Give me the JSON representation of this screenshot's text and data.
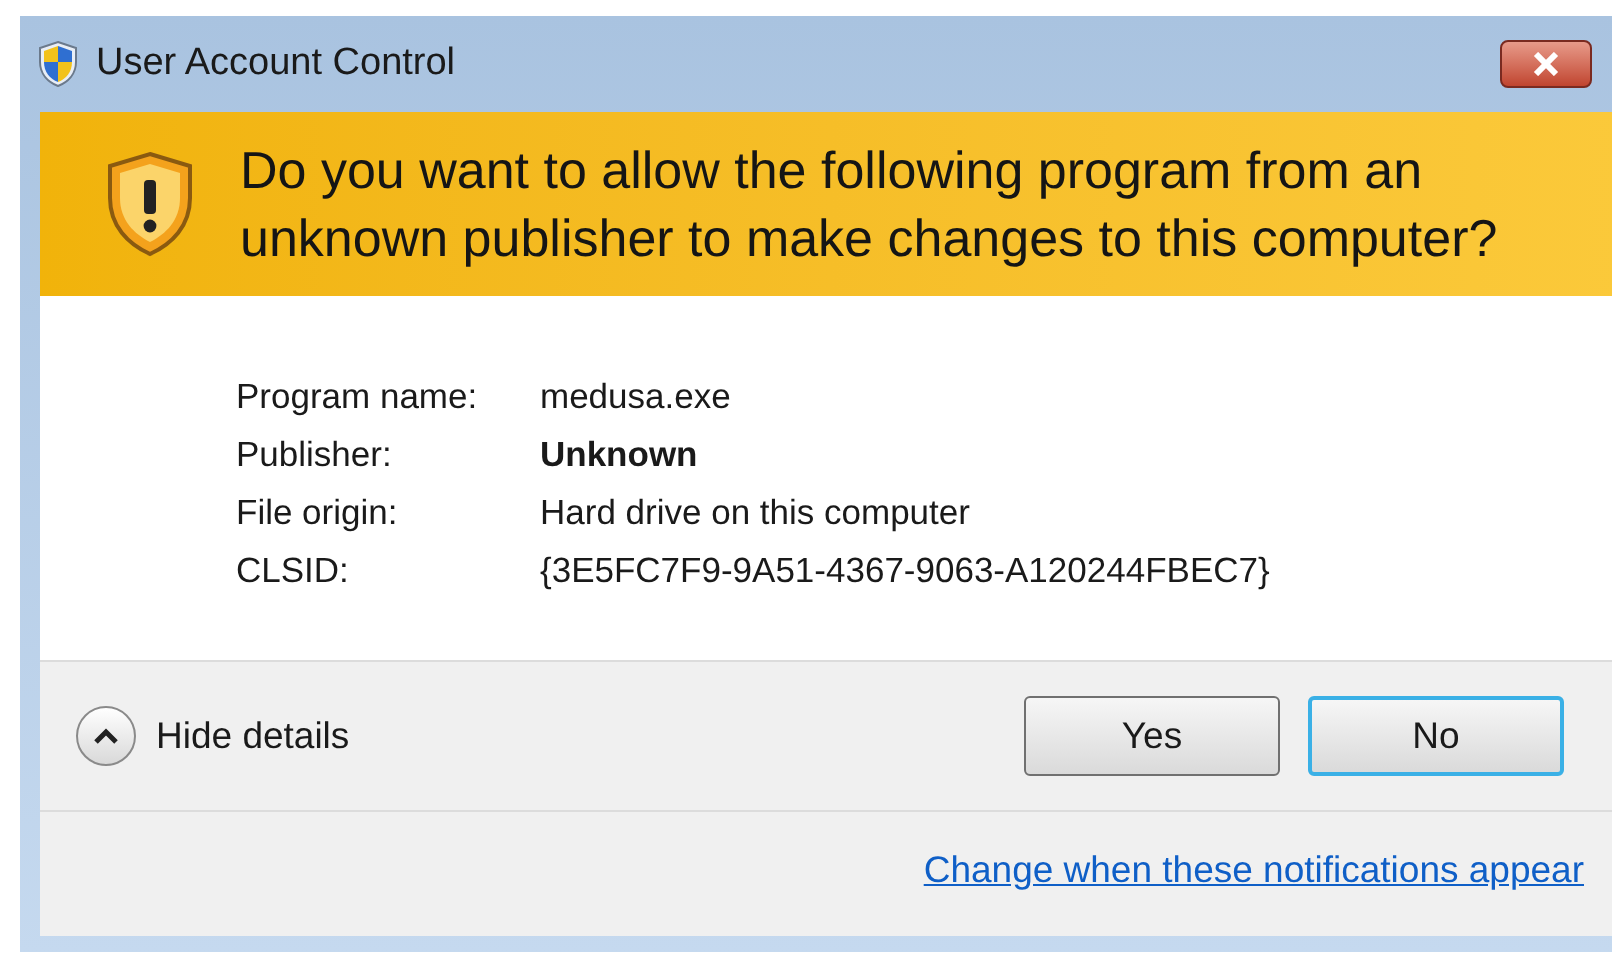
{
  "window": {
    "title": "User Account Control"
  },
  "banner": {
    "question": "Do you want to allow the following program from an unknown publisher to make changes to this computer?"
  },
  "details": [
    {
      "label": "Program name:",
      "value": "medusa.exe",
      "bold": false
    },
    {
      "label": "Publisher:",
      "value": "Unknown",
      "bold": true
    },
    {
      "label": "File origin:",
      "value": "Hard drive on this computer",
      "bold": false
    },
    {
      "label": "CLSID:",
      "value": "{3E5FC7F9-9A51-4367-9063-A120244FBEC7}",
      "bold": false
    }
  ],
  "toggle": {
    "label": "Hide details",
    "expanded": true
  },
  "buttons": [
    {
      "label": "Yes",
      "focused": false
    },
    {
      "label": "No",
      "focused": true
    }
  ],
  "footer_link": "Change when these notifications appear"
}
